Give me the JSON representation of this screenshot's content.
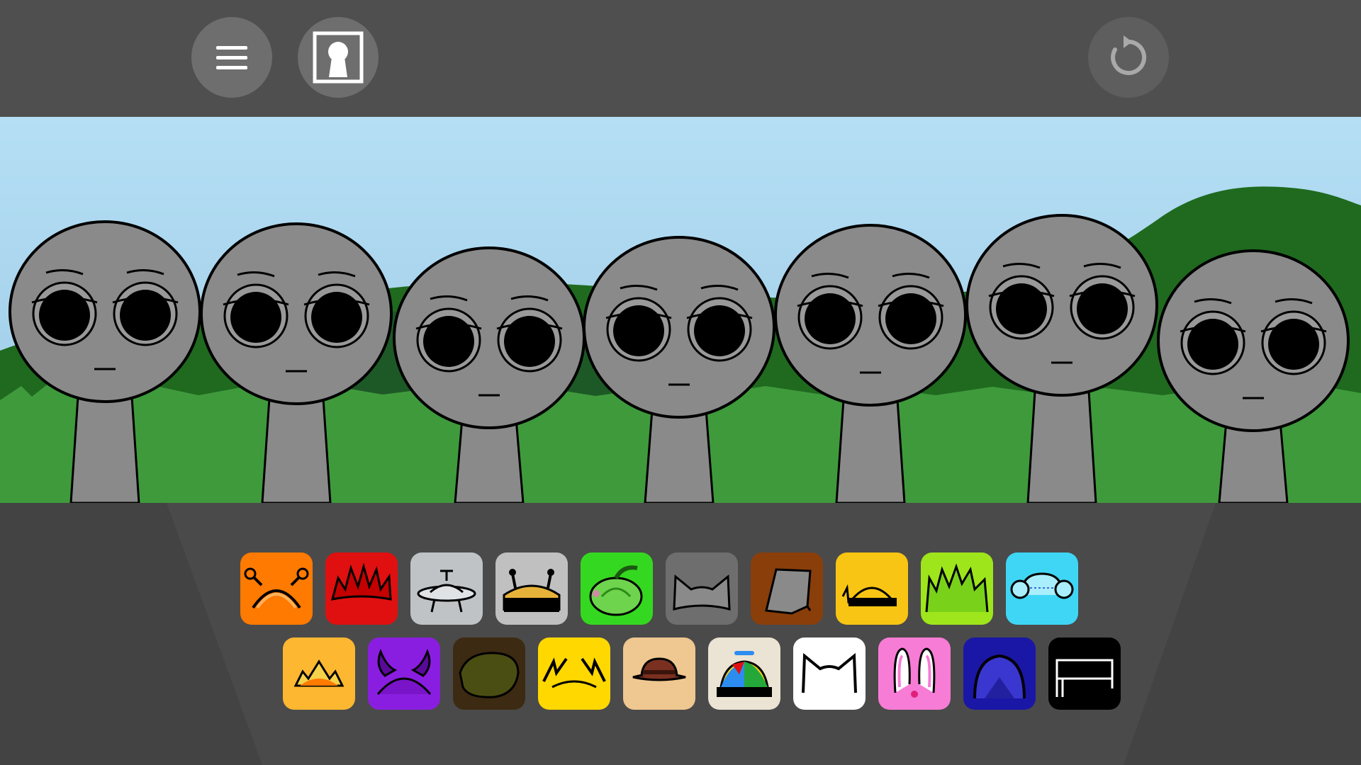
{
  "toolbar": {
    "buttons": [
      {
        "name": "menu-button",
        "icon": "hamburger-menu-icon"
      },
      {
        "name": "gallery-button",
        "icon": "keyhole-portrait-icon"
      },
      {
        "name": "reset-button",
        "icon": "refresh-icon"
      }
    ]
  },
  "stage": {
    "character_count": 7,
    "characters": [
      "idle",
      "idle",
      "idle",
      "idle",
      "idle",
      "idle",
      "idle"
    ],
    "sky_color": "#a8d4ea",
    "grass_color": "#3f9a3c",
    "body_color": "#8a8a8a"
  },
  "tray": {
    "row1": [
      {
        "icon": "orange-antenna-headband-icon",
        "color": "#ff7a00"
      },
      {
        "icon": "red-spiky-hair-icon",
        "color": "#e01010"
      },
      {
        "icon": "silver-ufo-icon",
        "color": "#bfc3c6"
      },
      {
        "icon": "gray-robot-antenna-icon",
        "color": "#c0c0c0"
      },
      {
        "icon": "green-melon-icon",
        "color": "#35d820"
      },
      {
        "icon": "gray-cat-ears-icon",
        "color": "#6e6e6e"
      },
      {
        "icon": "brown-bucket-icon",
        "color": "#8a3e0a"
      },
      {
        "icon": "yellow-headset-icon",
        "color": "#f8c514"
      },
      {
        "icon": "lime-spiky-hair-icon",
        "color": "#9fe51c"
      },
      {
        "icon": "cyan-headphones-icon",
        "color": "#3fd6f5"
      }
    ],
    "row2": [
      {
        "icon": "sun-crown-icon",
        "color": "#fdb731"
      },
      {
        "icon": "purple-horns-icon",
        "color": "#8a1ee0"
      },
      {
        "icon": "olive-fur-cap-icon",
        "color": "#3d2a12"
      },
      {
        "icon": "yellow-lightning-icon",
        "color": "#ffd800"
      },
      {
        "icon": "brown-fedora-icon",
        "color": "#efc790"
      },
      {
        "icon": "propeller-cap-icon",
        "color": "#ebe3d3"
      },
      {
        "icon": "white-cat-ears-icon",
        "color": "#ffffff"
      },
      {
        "icon": "pink-bunny-ears-icon",
        "color": "#f77cd6"
      },
      {
        "icon": "blue-hood-icon",
        "color": "#1a17a6"
      },
      {
        "icon": "black-bench-icon",
        "color": "#000000"
      }
    ]
  }
}
